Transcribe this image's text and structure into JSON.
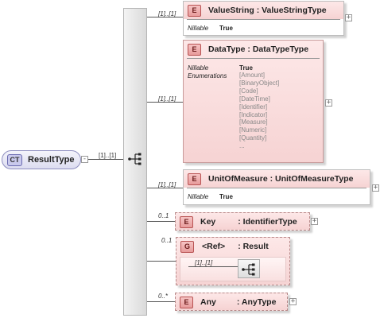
{
  "complex_type": {
    "badge": "CT",
    "name": "ResultType",
    "occurrence": "[1]..[1]",
    "collapse_symbol": "-"
  },
  "sequence": {
    "icon": "sequence-compositor-icon"
  },
  "expand_symbol": "+",
  "elements": [
    {
      "badge": "E",
      "name": "ValueString",
      "type": ": ValueStringType",
      "occurrence": "[1]..[1]",
      "properties": [
        {
          "label": "Nillable",
          "value": "True"
        }
      ]
    },
    {
      "badge": "E",
      "name": "DataType",
      "type": ": DataTypeType",
      "occurrence": "[1]..[1]",
      "properties": [
        {
          "label": "Nillable",
          "value": "True"
        },
        {
          "label": "Enumerations",
          "value": ""
        }
      ],
      "enumerations": [
        "[Amount]",
        "[BinaryObject]",
        "[Code]",
        "[DateTime]",
        "[Identifier]",
        "[Indicator]",
        "[Measure]",
        "[Numeric]",
        "[Quantity]",
        "..."
      ]
    },
    {
      "badge": "E",
      "name": "UnitOfMeasure",
      "type": ": UnitOfMeasureType",
      "occurrence": "[1]..[1]",
      "properties": [
        {
          "label": "Nillable",
          "value": "True"
        }
      ]
    },
    {
      "badge": "E",
      "name": "Key",
      "type": ": IdentifierType",
      "occurrence": "0..1"
    },
    {
      "badge": "E",
      "name": "Any",
      "type": ": AnyType",
      "occurrence": "0..*"
    }
  ],
  "group": {
    "badge": "G",
    "name": "<Ref>",
    "type": ": Result",
    "occurrence": "0..1",
    "inner_occurrence": "[1]..[1]"
  }
}
